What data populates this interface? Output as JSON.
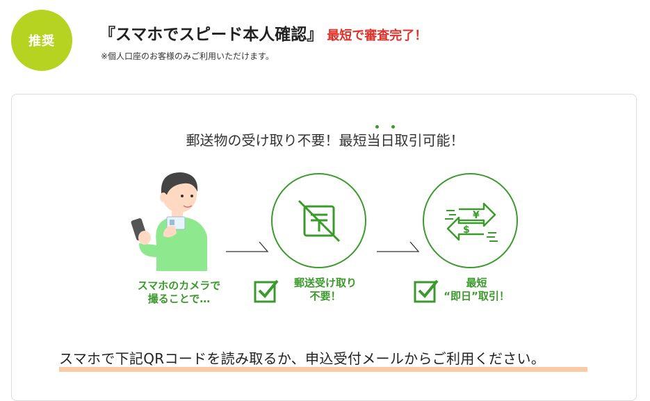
{
  "header": {
    "badge": "推奨",
    "title": "『スマホでスピード本人確認』",
    "title_accent": "最短で審査完了！",
    "note": "※個人口座のお客様のみご利用いただけます。"
  },
  "card": {
    "headline": "郵送物の受け取り不要！最短当日取引可能！",
    "steps": [
      {
        "line1": "スマホのカメラで",
        "line2": "撮ることで…"
      },
      {
        "line1": "郵送受け取り",
        "line2": "不要！"
      },
      {
        "line1": "最短",
        "line2": "“即日”取引！"
      }
    ],
    "instruction": "スマホで下記QRコードを読み取るか、申込受付メールからご利用ください。"
  },
  "colors": {
    "badge": "#b5d320",
    "accent_red": "#e0302a",
    "green": "#3b9a2c",
    "underline": "#fbc9a3"
  },
  "icons": [
    "person-with-phone-illustration",
    "no-mail-icon",
    "currency-exchange-icon",
    "checkbox-icon"
  ]
}
